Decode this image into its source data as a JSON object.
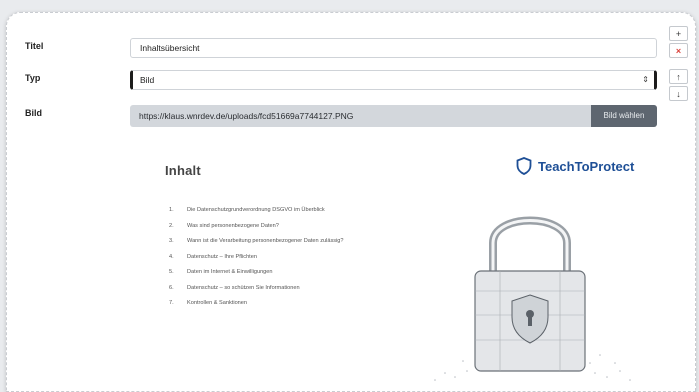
{
  "form": {
    "titel_label": "Titel",
    "titel_value": "Inhaltsübersicht",
    "typ_label": "Typ",
    "typ_value": "Bild",
    "bild_label": "Bild",
    "bild_url": "https://klaus.wnrdev.de/uploads/fcd51669a7744127.PNG",
    "choose_button": "Bild wählen"
  },
  "side_controls": {
    "add": "+",
    "remove": "×",
    "up": "↑",
    "down": "↓"
  },
  "preview": {
    "heading": "Inhalt",
    "brand": "TeachToProtect",
    "items": [
      {
        "num": "1.",
        "text": "Die Datenschutzgrundverordnung DSGVO im Überblick"
      },
      {
        "num": "2.",
        "text": "Was sind personenbezogene Daten?"
      },
      {
        "num": "3.",
        "text": "Wann ist die Verarbeitung personenbezogener Daten zulässig?"
      },
      {
        "num": "4.",
        "text": "Datenschutz – Ihre Pflichten"
      },
      {
        "num": "5.",
        "text": "Daten im Internet & Einwilligungen"
      },
      {
        "num": "6.",
        "text": "Datenschutz – so schützen Sie Informationen"
      },
      {
        "num": "7.",
        "text": "Kontrollen & Sanktionen"
      }
    ]
  },
  "colors": {
    "brand": "#1e4f96",
    "remove": "#d9413a",
    "button_bg": "#5e6670"
  }
}
